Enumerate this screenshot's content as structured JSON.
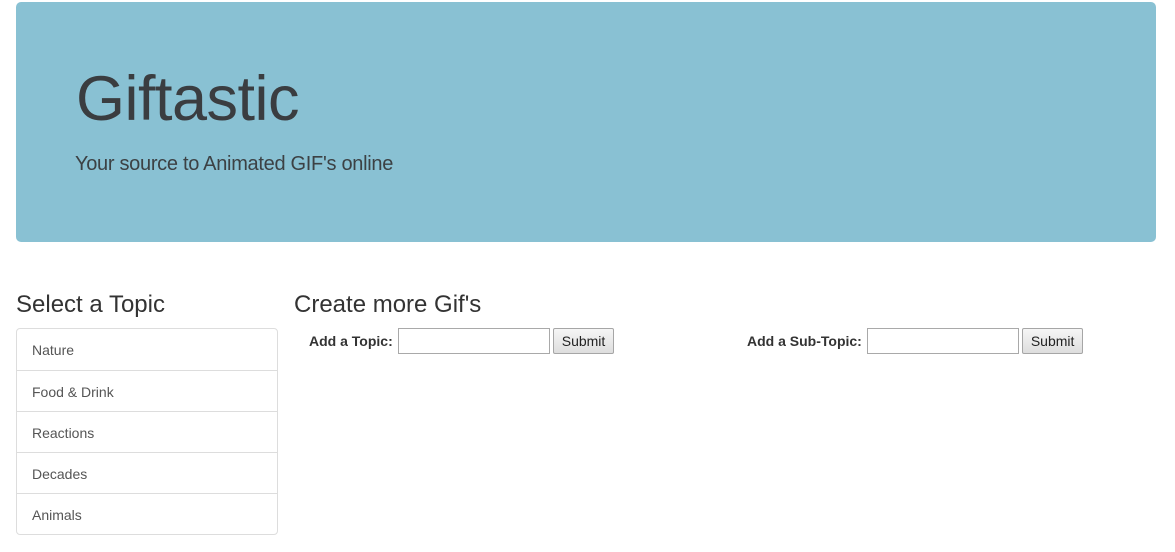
{
  "header": {
    "title": "Giftastic",
    "subtitle": "Your source to Animated GIF's online"
  },
  "topics": {
    "heading": "Select a Topic",
    "items": [
      {
        "label": "Nature"
      },
      {
        "label": "Food & Drink"
      },
      {
        "label": "Reactions"
      },
      {
        "label": "Decades"
      },
      {
        "label": "Animals"
      }
    ]
  },
  "create": {
    "heading": "Create more Gif's",
    "topic_form": {
      "label": "Add a Topic:",
      "value": "",
      "submit_label": "Submit"
    },
    "subtopic_form": {
      "label": "Add a Sub-Topic:",
      "value": "",
      "submit_label": "Submit"
    }
  },
  "colors": {
    "jumbotron_bg": "#89c1d3",
    "title_text": "#3a3d40"
  }
}
